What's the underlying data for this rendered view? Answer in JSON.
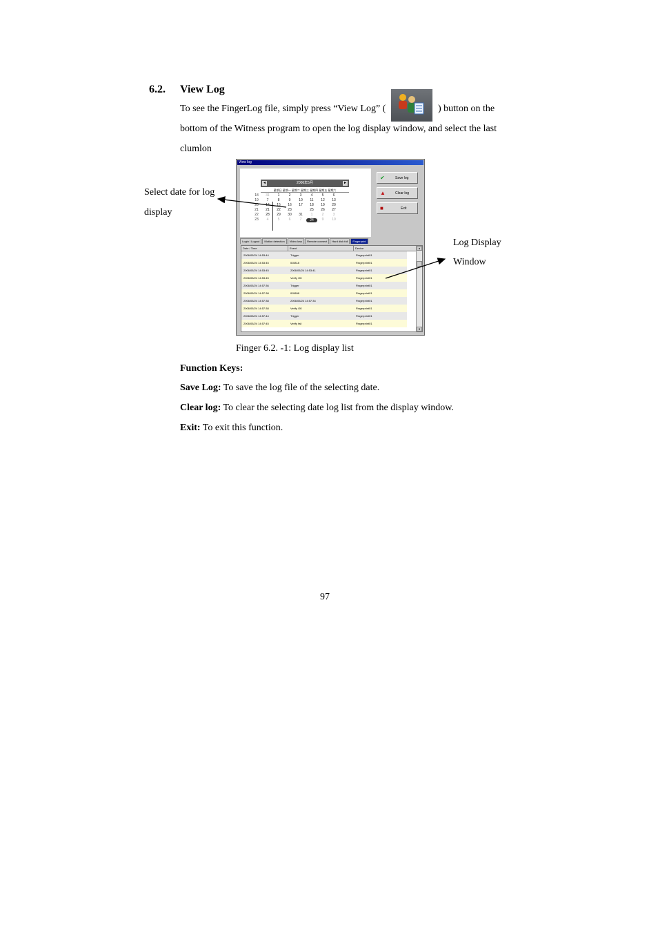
{
  "section": {
    "number": "6.2.",
    "title": "View Log"
  },
  "intro": {
    "line1_before": "To see the FingerLog file, simply press “View Log” (",
    "line1_after": ") button on the",
    "line2": "bottom of the Witness program to open the log display window, and select the last",
    "line3": "clumlon"
  },
  "callouts": {
    "left_line1": "Select date for log",
    "left_line2": "display",
    "right_line1": "Log Display",
    "right_line2": "Window"
  },
  "window": {
    "title": "View log",
    "calendar": {
      "header": "2006年5月",
      "prev": "◄",
      "next": "►",
      "weekdays": "星期日 星期一 星期二 星期三 星期四 星期五 星期六",
      "rows": [
        [
          "18",
          "31",
          "1",
          "2",
          "3",
          "4",
          "5",
          "6"
        ],
        [
          "19",
          "7",
          "8",
          "9",
          "10",
          "11",
          "12",
          "13"
        ],
        [
          "20",
          "14",
          "15",
          "16",
          "17",
          "18",
          "19",
          "20"
        ],
        [
          "21",
          "21",
          "22",
          "23",
          "24",
          "25",
          "26",
          "27"
        ],
        [
          "22",
          "28",
          "29",
          "30",
          "31",
          "1",
          "2",
          "3"
        ],
        [
          "23",
          "4",
          "5",
          "6",
          "7",
          "8",
          "9",
          "10"
        ]
      ],
      "selected_day": "24"
    },
    "buttons": {
      "save": "Save log",
      "clear": "Clear log",
      "exit": "Exit"
    },
    "tabs": [
      "Login / Logout",
      "Motion detection",
      "Video loss",
      "Remote connect",
      "Hard disk full",
      "Fingerprint"
    ],
    "active_tab": "Fingerprint",
    "columns": [
      "Date / Time",
      "Event",
      "Device"
    ],
    "rows": [
      [
        "2006/05/24 14:53:44",
        "Trigger",
        "Fingerprint01"
      ],
      [
        "2006/05/24 14:53:45",
        "ID0818",
        "Fingerprint01"
      ],
      [
        "2006/05/24 14:53:45",
        "2006/05/24 14:53:41",
        "Fingerprint01"
      ],
      [
        "2006/05/24 14:53:45",
        "Verify OK",
        "Fingerprint01"
      ],
      [
        "2006/05/24 14:57:36",
        "Trigger",
        "Fingerprint01"
      ],
      [
        "2006/05/24 14:57:38",
        "ID0808",
        "Fingerprint01"
      ],
      [
        "2006/05/24 14:57:38",
        "2006/05/24 14:57:34",
        "Fingerprint01"
      ],
      [
        "2006/05/24 14:57:38",
        "Verify OK",
        "Fingerprint01"
      ],
      [
        "2006/05/24 14:57:44",
        "Trigger",
        "Fingerprint01"
      ],
      [
        "2006/05/24 14:57:45",
        "Verify fail",
        "Fingerprint01"
      ]
    ]
  },
  "caption": "Finger 6.2. -1: Log display list",
  "function_keys": {
    "heading": "Function Keys:",
    "save_term": "Save Log:",
    "save_desc": " To save the log file of the selecting date.",
    "clear_term": "Clear log:",
    "clear_desc": " To clear the selecting date log list from the display window.",
    "exit_term": "Exit:",
    "exit_desc": " To exit this function."
  },
  "page_number": "97",
  "icons": {
    "toolbar": "view-log-icon",
    "save": "checkmark-icon",
    "clear": "eraser-icon",
    "exit": "exit-door-icon"
  }
}
